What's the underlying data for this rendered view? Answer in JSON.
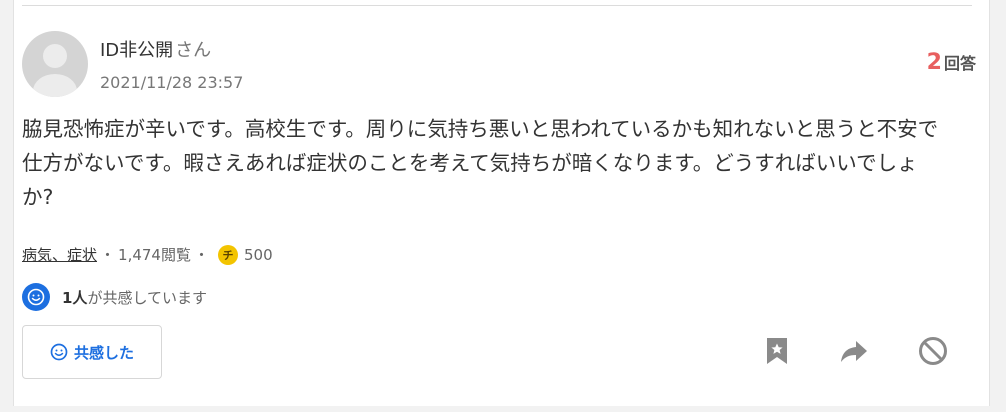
{
  "question": {
    "user_name": "ID非公開",
    "user_suffix": "さん",
    "posted_at": "2021/11/28 23:57",
    "answer_count": "2",
    "answer_label": "回答",
    "body": "脇見恐怖症が辛いです。高校生です。周りに気持ち悪いと思われているかも知れないと思うと不安で仕方がないです。暇さえあれば症状のことを考えて気持ちが暗くなります。どうすればいいでしょか?",
    "category": "病気、症状",
    "views": "1,474閲覧",
    "separator": "・",
    "coin_glyph": "チ",
    "coin_amount": "500",
    "empathy_count": "1人",
    "empathy_text": "が共感しています",
    "empathy_button_label": "共感した"
  },
  "icons": {
    "avatar": "default-avatar-icon",
    "coin": "chiebukuro-coin-icon",
    "empathy": "smile-icon",
    "bookmark": "bookmark-icon",
    "share": "share-arrow-icon",
    "block": "block-icon"
  },
  "colors": {
    "accent_blue": "#1d6fe0",
    "answer_count_red": "#e85f5f",
    "coin_yellow": "#f3c400",
    "icon_gray": "#8a8a8a"
  }
}
